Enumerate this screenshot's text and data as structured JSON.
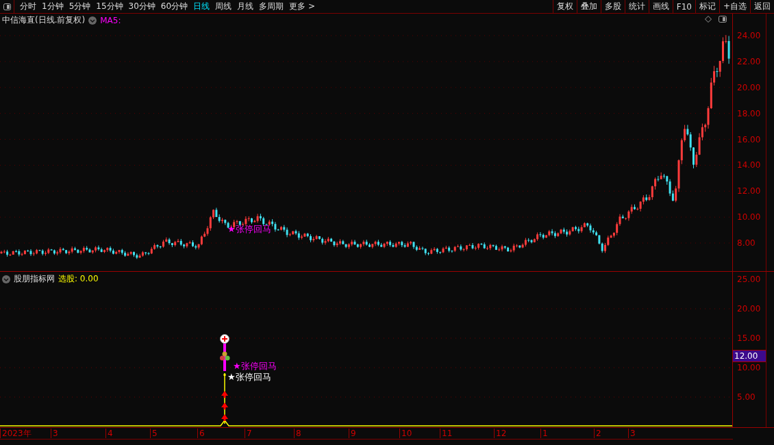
{
  "toolbar": {
    "periods": [
      {
        "label": "分时",
        "selected": false
      },
      {
        "label": "1分钟",
        "selected": false
      },
      {
        "label": "5分钟",
        "selected": false
      },
      {
        "label": "15分钟",
        "selected": false
      },
      {
        "label": "30分钟",
        "selected": false
      },
      {
        "label": "60分钟",
        "selected": false
      },
      {
        "label": "日线",
        "selected": true
      },
      {
        "label": "周线",
        "selected": false
      },
      {
        "label": "月线",
        "selected": false
      },
      {
        "label": "多周期",
        "selected": false
      },
      {
        "label": "更多 >",
        "selected": false
      }
    ],
    "buttons": [
      "复权",
      "叠加",
      "多股",
      "统计",
      "画线",
      "F10",
      "标记",
      "+自选",
      "返回"
    ]
  },
  "price_panel": {
    "title": "中信海直(日线.前复权)",
    "ma_label": "MA5:",
    "signal_label": "★张停回马",
    "axis_ticks": [
      "24.00",
      "22.00",
      "20.00",
      "18.00",
      "16.00",
      "14.00",
      "12.00",
      "10.00",
      "8.00"
    ]
  },
  "indicator_panel": {
    "title": "股朋指标网",
    "value_label": "选股: 0.00",
    "signal_labels": [
      {
        "text": "★张停回马",
        "color": "#ff00ff"
      },
      {
        "text": "★张停回马",
        "color": "#ffffff"
      }
    ],
    "axis_ticks": [
      "25.00",
      "20.00",
      "15.00",
      "10.00",
      "5.00"
    ],
    "current_value": "12.00"
  },
  "time_axis": [
    "2023年",
    "3",
    "4",
    "5",
    "6",
    "7",
    "8",
    "9",
    "10",
    "11",
    "12",
    "1",
    "2",
    "3"
  ]
}
